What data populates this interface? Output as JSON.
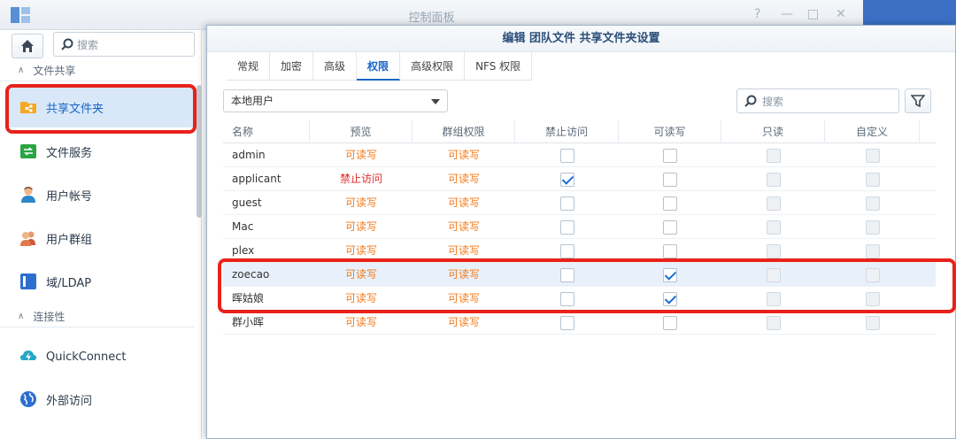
{
  "window": {
    "title": "控制面板"
  },
  "sidebar": {
    "search_placeholder": "搜索",
    "section1": "文件共享",
    "section2": "连接性",
    "items": [
      {
        "label": "共享文件夹",
        "icon": "shared-folder-icon",
        "color": "#f7a823"
      },
      {
        "label": "文件服务",
        "icon": "file-services-icon",
        "color": "#2aa544"
      },
      {
        "label": "用户帐号",
        "icon": "user-icon",
        "color": "#e07a4b"
      },
      {
        "label": "用户群组",
        "icon": "group-icon",
        "color": "#e07a4b"
      },
      {
        "label": "域/LDAP",
        "icon": "domain-ldap-icon",
        "color": "#2d6fcf"
      },
      {
        "label": "QuickConnect",
        "icon": "quickconnect-icon",
        "color": "#24a8c6"
      },
      {
        "label": "外部访问",
        "icon": "external-access-icon",
        "color": "#2d6fcf"
      }
    ]
  },
  "dialog": {
    "title": "编辑 团队文件 共享文件夹设置",
    "tabs": [
      "常规",
      "加密",
      "高级",
      "权限",
      "高级权限",
      "NFS 权限"
    ],
    "active_tab": "权限",
    "user_scope": "本地用户",
    "search_placeholder": "搜索",
    "columns": [
      "名称",
      "预览",
      "群组权限",
      "禁止访问",
      "可读写",
      "只读",
      "自定义"
    ],
    "rows": [
      {
        "name": "admin",
        "preview": "可读写",
        "group": "可读写",
        "deny": false,
        "rw": false,
        "ro": false,
        "custom": false,
        "preview_deny": false
      },
      {
        "name": "applicant",
        "preview": "禁止访问",
        "group": "可读写",
        "deny": true,
        "rw": false,
        "ro": false,
        "custom": false,
        "preview_deny": true
      },
      {
        "name": "guest",
        "preview": "可读写",
        "group": "可读写",
        "deny": false,
        "rw": false,
        "ro": false,
        "custom": false,
        "preview_deny": false
      },
      {
        "name": "Mac",
        "preview": "可读写",
        "group": "可读写",
        "deny": false,
        "rw": false,
        "ro": false,
        "custom": false,
        "preview_deny": false
      },
      {
        "name": "plex",
        "preview": "可读写",
        "group": "可读写",
        "deny": false,
        "rw": false,
        "ro": false,
        "custom": false,
        "preview_deny": false
      },
      {
        "name": "zoecao",
        "preview": "可读写",
        "group": "可读写",
        "deny": false,
        "rw": true,
        "ro": false,
        "custom": false,
        "preview_deny": false
      },
      {
        "name": "晖姑娘",
        "preview": "可读写",
        "group": "可读写",
        "deny": false,
        "rw": true,
        "ro": false,
        "custom": false,
        "preview_deny": false
      },
      {
        "name": "群小晖",
        "preview": "可读写",
        "group": "可读写",
        "deny": false,
        "rw": false,
        "ro": false,
        "custom": false,
        "preview_deny": false
      }
    ]
  },
  "colors": {
    "accent": "#1a66c6",
    "highlight": "#e8221b",
    "permission_text": "#f57a1a",
    "deny_text": "#e02b2b"
  }
}
